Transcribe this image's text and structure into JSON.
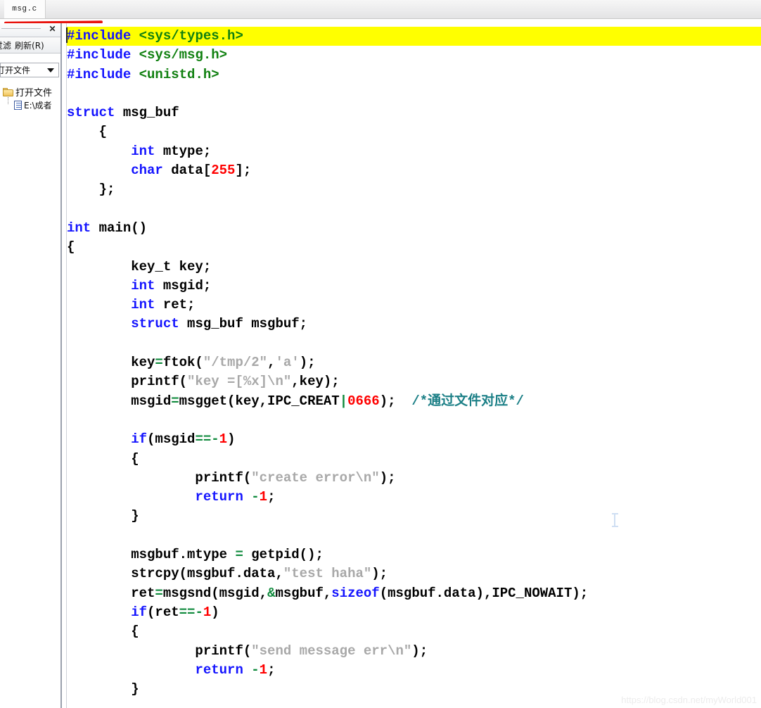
{
  "window": {
    "tab": {
      "label": "msg.c"
    },
    "watermark": "https://blog.csdn.net/myWorld001"
  },
  "left_panel": {
    "close_icon": "✕",
    "toolbar": [
      {
        "label": "过滤"
      },
      {
        "label": "刷新(R)"
      }
    ],
    "dropdown": {
      "selected": "打开文件",
      "caret_icon": "chevron-down-icon"
    },
    "tree": [
      {
        "icon": "folder-icon",
        "label": "打开文件"
      },
      {
        "icon": "file-icon",
        "label": "E:\\成者"
      }
    ]
  },
  "editor": {
    "highlight_line_index": 0,
    "colors": {
      "keyword": "#1414ff",
      "preprocessor": "#1414ff",
      "header": "#108010",
      "number": "#ff0000",
      "string": "#a8a8a8",
      "operator": "#0f8a3c",
      "comment": "#1b7f86",
      "highlight_bg": "#ffff00"
    },
    "lines": [
      [
        {
          "t": "#include",
          "c": "pp"
        },
        {
          "t": " ",
          "c": "plain"
        },
        {
          "t": "<sys/types.h>",
          "c": "hdr"
        }
      ],
      [
        {
          "t": "#include",
          "c": "pp"
        },
        {
          "t": " ",
          "c": "plain"
        },
        {
          "t": "<sys/msg.h>",
          "c": "hdr"
        }
      ],
      [
        {
          "t": "#include",
          "c": "pp"
        },
        {
          "t": " ",
          "c": "plain"
        },
        {
          "t": "<unistd.h>",
          "c": "hdr"
        }
      ],
      [],
      [
        {
          "t": "struct",
          "c": "kw"
        },
        {
          "t": " msg_buf",
          "c": "plain"
        }
      ],
      [
        {
          "t": "    {",
          "c": "plain"
        }
      ],
      [
        {
          "t": "        ",
          "c": "plain"
        },
        {
          "t": "int",
          "c": "kw"
        },
        {
          "t": " mtype;",
          "c": "plain"
        }
      ],
      [
        {
          "t": "        ",
          "c": "plain"
        },
        {
          "t": "char",
          "c": "kw"
        },
        {
          "t": " data[",
          "c": "plain"
        },
        {
          "t": "255",
          "c": "num"
        },
        {
          "t": "];",
          "c": "plain"
        }
      ],
      [
        {
          "t": "    };",
          "c": "plain"
        }
      ],
      [],
      [
        {
          "t": "int",
          "c": "kw"
        },
        {
          "t": " main()",
          "c": "plain"
        }
      ],
      [
        {
          "t": "{",
          "c": "plain"
        }
      ],
      [
        {
          "t": "        key_t key;",
          "c": "plain"
        }
      ],
      [
        {
          "t": "        ",
          "c": "plain"
        },
        {
          "t": "int",
          "c": "kw"
        },
        {
          "t": " msgid;",
          "c": "plain"
        }
      ],
      [
        {
          "t": "        ",
          "c": "plain"
        },
        {
          "t": "int",
          "c": "kw"
        },
        {
          "t": " ret;",
          "c": "plain"
        }
      ],
      [
        {
          "t": "        ",
          "c": "plain"
        },
        {
          "t": "struct",
          "c": "kw"
        },
        {
          "t": " msg_buf msgbuf;",
          "c": "plain"
        }
      ],
      [],
      [
        {
          "t": "        key",
          "c": "plain"
        },
        {
          "t": "=",
          "c": "op"
        },
        {
          "t": "ftok(",
          "c": "plain"
        },
        {
          "t": "\"/tmp/2\"",
          "c": "str"
        },
        {
          "t": ",",
          "c": "plain"
        },
        {
          "t": "'a'",
          "c": "str"
        },
        {
          "t": ");",
          "c": "plain"
        }
      ],
      [
        {
          "t": "        printf(",
          "c": "plain"
        },
        {
          "t": "\"key =[%x]\\n\"",
          "c": "str"
        },
        {
          "t": ",key);",
          "c": "plain"
        }
      ],
      [
        {
          "t": "        msgid",
          "c": "plain"
        },
        {
          "t": "=",
          "c": "op"
        },
        {
          "t": "msgget(key,IPC_CREAT",
          "c": "plain"
        },
        {
          "t": "|",
          "c": "op"
        },
        {
          "t": "0666",
          "c": "num"
        },
        {
          "t": ");  ",
          "c": "plain"
        },
        {
          "t": "/*通过文件对应*/",
          "c": "cmt"
        }
      ],
      [],
      [
        {
          "t": "        ",
          "c": "plain"
        },
        {
          "t": "if",
          "c": "kw"
        },
        {
          "t": "(msgid",
          "c": "plain"
        },
        {
          "t": "==-",
          "c": "op"
        },
        {
          "t": "1",
          "c": "num"
        },
        {
          "t": ")",
          "c": "plain"
        }
      ],
      [
        {
          "t": "        {",
          "c": "plain"
        }
      ],
      [
        {
          "t": "                printf(",
          "c": "plain"
        },
        {
          "t": "\"create error\\n\"",
          "c": "str"
        },
        {
          "t": ");",
          "c": "plain"
        }
      ],
      [
        {
          "t": "                ",
          "c": "plain"
        },
        {
          "t": "return",
          "c": "kw"
        },
        {
          "t": " ",
          "c": "plain"
        },
        {
          "t": "-",
          "c": "op"
        },
        {
          "t": "1",
          "c": "num"
        },
        {
          "t": ";",
          "c": "plain"
        }
      ],
      [
        {
          "t": "        }",
          "c": "plain"
        }
      ],
      [],
      [
        {
          "t": "        msgbuf.mtype ",
          "c": "plain"
        },
        {
          "t": "=",
          "c": "op"
        },
        {
          "t": " getpid();",
          "c": "plain"
        }
      ],
      [
        {
          "t": "        strcpy(msgbuf.data,",
          "c": "plain"
        },
        {
          "t": "\"test haha\"",
          "c": "str"
        },
        {
          "t": ");",
          "c": "plain"
        }
      ],
      [
        {
          "t": "        ret",
          "c": "plain"
        },
        {
          "t": "=",
          "c": "op"
        },
        {
          "t": "msgsnd(msgid,",
          "c": "plain"
        },
        {
          "t": "&",
          "c": "op"
        },
        {
          "t": "msgbuf,",
          "c": "plain"
        },
        {
          "t": "sizeof",
          "c": "kw"
        },
        {
          "t": "(msgbuf.data),IPC_NOWAIT);",
          "c": "plain"
        }
      ],
      [
        {
          "t": "        ",
          "c": "plain"
        },
        {
          "t": "if",
          "c": "kw"
        },
        {
          "t": "(ret",
          "c": "plain"
        },
        {
          "t": "==-",
          "c": "op"
        },
        {
          "t": "1",
          "c": "num"
        },
        {
          "t": ")",
          "c": "plain"
        }
      ],
      [
        {
          "t": "        {",
          "c": "plain"
        }
      ],
      [
        {
          "t": "                printf(",
          "c": "plain"
        },
        {
          "t": "\"send message err\\n\"",
          "c": "str"
        },
        {
          "t": ");",
          "c": "plain"
        }
      ],
      [
        {
          "t": "                ",
          "c": "plain"
        },
        {
          "t": "return",
          "c": "kw"
        },
        {
          "t": " ",
          "c": "plain"
        },
        {
          "t": "-",
          "c": "op"
        },
        {
          "t": "1",
          "c": "num"
        },
        {
          "t": ";",
          "c": "plain"
        }
      ],
      [
        {
          "t": "        }",
          "c": "plain"
        }
      ]
    ]
  }
}
